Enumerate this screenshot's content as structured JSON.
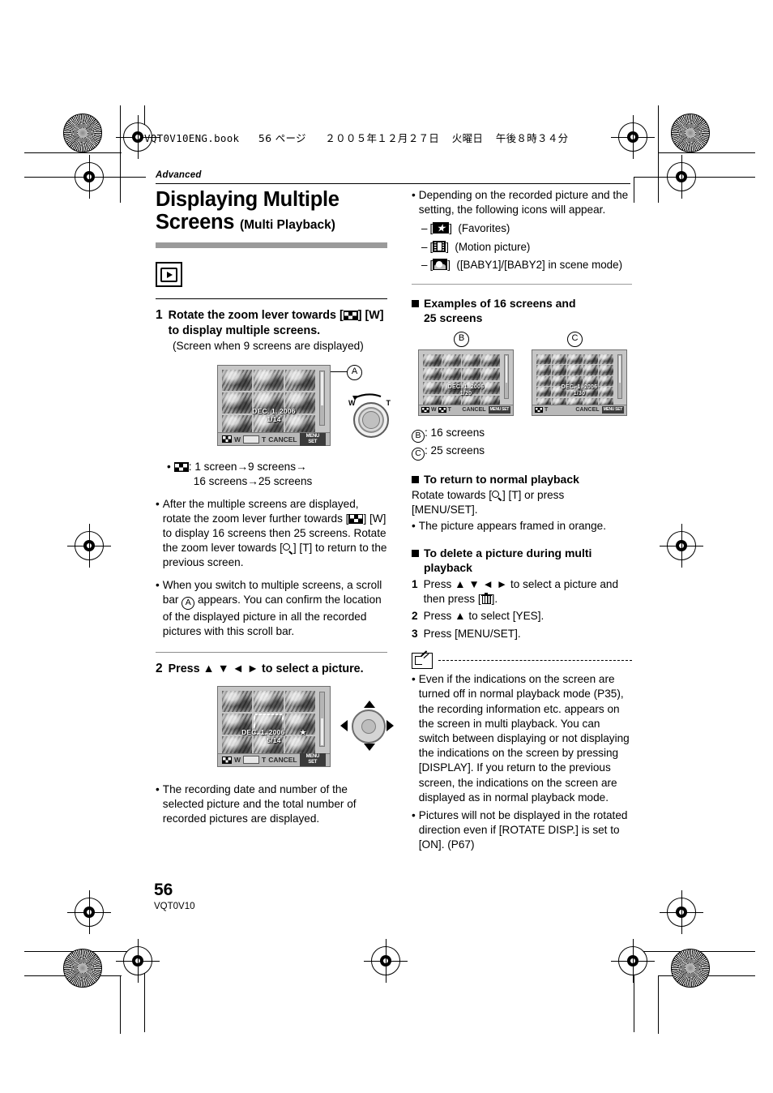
{
  "print_header": {
    "filename": "VQT0V10ENG.book",
    "page_label": "56 ページ",
    "date": "２００５年１２月２７日",
    "weekday": "火曜日",
    "time": "午後８時３４分"
  },
  "section_label": "Advanced",
  "title": {
    "main_line1": "Displaying Multiple",
    "main_line2": "Screens",
    "subtitle": "(Multi Playback)"
  },
  "mode_icon": "playback-mode-icon",
  "left_column": {
    "step1": {
      "number": "1",
      "text_before": "Rotate the zoom lever towards",
      "icon": "multi-screen-icon",
      "text_after": "[W] to display multiple screens.",
      "note": "(Screen when 9 screens are displayed)"
    },
    "screen1": {
      "date": "DEC. 1. 2006",
      "counter": "1/14",
      "bar_w": "W",
      "bar_t": "T",
      "bar_cancel": "CANCEL",
      "bar_menu_btn": "MENU SET",
      "callout": "A",
      "dial_w": "W",
      "dial_t": "T"
    },
    "bullets": [
      {
        "icon": "multi-screen-icon",
        "text_line1": ":  1 screen→9 screens→",
        "text_line2": "16 screens→25 screens"
      },
      {
        "text": "After the multiple screens are displayed, rotate the zoom lever further towards [■] [W] to display 16 screens then 25 screens. Rotate the zoom lever towards [○] [T] to return to the previous screen.",
        "part1": "After the multiple screens are displayed, rotate the zoom lever further towards [",
        "part2": "] [W] to display 16 screens then 25 screens. Rotate the zoom lever towards [",
        "part3": "] [T] to return to the previous screen."
      },
      {
        "part1": "When you switch to multiple screens, a scroll bar ",
        "ref": "A",
        "part2": " appears. You can confirm the location of the displayed picture in all the recorded pictures with this scroll bar."
      }
    ],
    "step2": {
      "number": "2",
      "text": "Press ▲ ▼ ◄ ► to select a picture."
    },
    "screen2": {
      "date": "DEC. 1. 2006",
      "counter": "5/14",
      "favorite_marker": "★",
      "bar_w": "W",
      "bar_t": "T",
      "bar_cancel": "CANCEL",
      "bar_menu_btn": "MENU SET"
    },
    "bullet_after_step2": "The recording date and number of the selected picture and the total number of recorded pictures are displayed."
  },
  "right_column": {
    "icons_bullet": {
      "intro": "Depending on the recorded picture and the setting, the following icons will appear.",
      "items": [
        {
          "icon": "favorites-star-icon",
          "label": "(Favorites)"
        },
        {
          "icon": "motion-picture-film-icon",
          "label": "(Motion picture)"
        },
        {
          "icon": "baby-scene-icon",
          "label": "([BABY1]/[BABY2] in scene mode)"
        }
      ]
    },
    "examples_heading_line1": "Examples of 16 screens and",
    "examples_heading_line2": "25 screens",
    "screen_b": {
      "callout": "B",
      "date": "DEC. 1. 2006",
      "counter": "1/20",
      "bar_w": "W",
      "bar_t": "T",
      "bar_cancel": "CANCEL",
      "bar_menu_btn": "MENU SET"
    },
    "screen_c": {
      "callout": "C",
      "date": "DEC. 1. 2006",
      "counter": "1/30",
      "bar_t": "T",
      "bar_cancel": "CANCEL",
      "bar_menu_btn": "MENU SET"
    },
    "legend": [
      {
        "ref": "B",
        "text": ":  16 screens"
      },
      {
        "ref": "C",
        "text": ":  25 screens"
      }
    ],
    "return_section": {
      "heading": "To return to normal playback",
      "line_part1": "Rotate towards [",
      "line_part2": "] [T] or press [MENU/SET].",
      "bullet": "The picture appears framed in orange."
    },
    "delete_section": {
      "heading_line1": "To delete a picture during multi",
      "heading_line2": "playback",
      "steps": [
        {
          "num": "1",
          "part1": "Press ▲ ▼ ◄ ► to select a picture and then press [",
          "part2": "]."
        },
        {
          "num": "2",
          "text": "Press ▲ to select [YES]."
        },
        {
          "num": "3",
          "text": "Press [MENU/SET]."
        }
      ]
    },
    "note_section": {
      "icon": "note-memo-icon",
      "bullets": [
        "Even if the indications on the screen are turned off in normal playback mode (P35), the recording information etc. appears on the screen in multi playback. You can switch between displaying or not displaying the indications on the screen by pressing [DISPLAY]. If you return to the previous screen, the indications on the screen are displayed as in normal playback mode.",
        "Pictures will not be displayed in the rotated direction even if [ROTATE DISP.] is set to [ON]. (P67)"
      ]
    }
  },
  "footer": {
    "page_number": "56",
    "doc_code": "VQT0V10"
  }
}
